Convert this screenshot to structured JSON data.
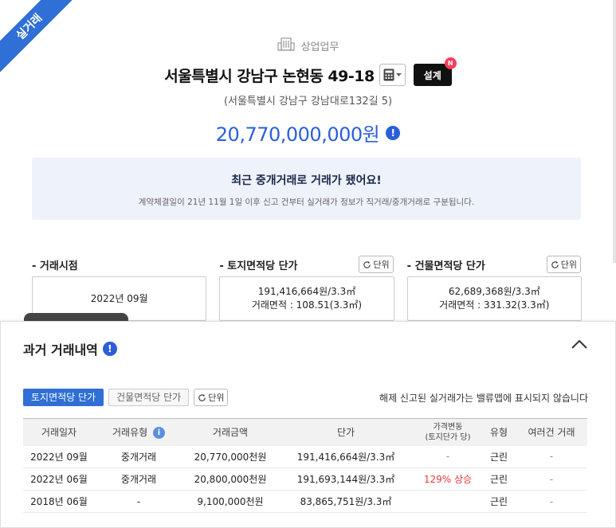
{
  "ribbon": "실거래",
  "category": "상업업무",
  "title": "서울특별시 강남구 논현동 49-18",
  "design_button": "설계",
  "new_badge": "N",
  "road_address": "(서울특별시 강남구 강남대로132길 5)",
  "price": "20,770,000,000원",
  "notice": {
    "title": "최근 중개거래로 거래가 됐어요!",
    "desc": "계약체결일이 21년 11월 1일 이후 신고 건부터 실거래가 정보가 직거래/중개거래로 구분됩니다."
  },
  "stats": [
    {
      "label": "- 거래시점",
      "line1": "2022년 09월",
      "line2": ""
    },
    {
      "label": "- 토지면적당 단가",
      "unit": "단위",
      "line1": "191,416,664원/3.3㎡",
      "line2": "거래면적 : 108.51(3.3㎡)"
    },
    {
      "label": "- 건물면적당 단가",
      "unit": "단위",
      "line1": "62,689,368원/3.3㎡",
      "line2": "거래면적 : 331.32(3.3㎡)"
    }
  ],
  "history": {
    "title": "과거 거래내역",
    "tabs": [
      "토지면적당 단가",
      "건물면적당 단가"
    ],
    "unit_button": "단위",
    "hint": "해제 신고된 실거래가는 밸류맵에 표시되지 않습니다",
    "columns": [
      "거래일자",
      "거래유형",
      "거래금액",
      "단가",
      "가격변동",
      "(토지단가 당)",
      "유형",
      "여러건 거래"
    ],
    "rows": [
      [
        "2022년 09월",
        "중개거래",
        "20,770,000천원",
        "191,416,664원/3.3㎡",
        "-",
        "근린",
        "-"
      ],
      [
        "2022년 06월",
        "중개거래",
        "20,800,000천원",
        "191,693,144원/3.3㎡",
        "129% 상승",
        "근린",
        "-"
      ],
      [
        "2018년 06월",
        "-",
        "9,100,000천원",
        "83,865,751원/3.3㎡",
        "",
        "근린",
        "-"
      ]
    ]
  },
  "colors": {
    "accent": "#2f6fd6",
    "price": "#2b5fd9",
    "rise": "#e8383d"
  }
}
